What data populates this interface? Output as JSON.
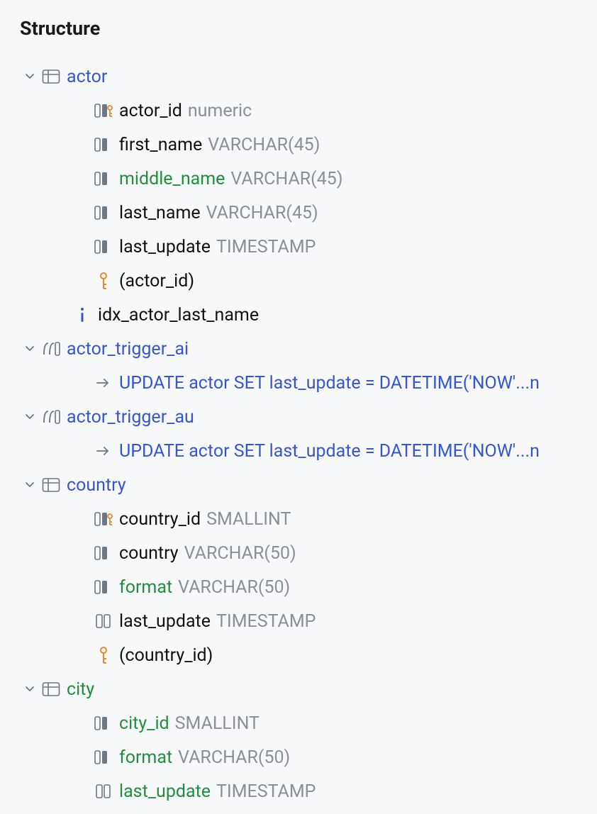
{
  "title": "Structure",
  "colors": {
    "blue": "#3556d1",
    "green": "#1f8f3b",
    "black": "#111",
    "grey": "#8a8f99",
    "orange": "#e28a2b"
  },
  "rows": [
    {
      "id": "actor",
      "depth": 0,
      "chevron": true,
      "icon": "table",
      "label": "actor",
      "label_color": "blue"
    },
    {
      "id": "actor_id",
      "depth": 1,
      "chevron": false,
      "icon": "col-key",
      "label": "actor_id",
      "label_color": "black",
      "type": "numeric"
    },
    {
      "id": "first_name",
      "depth": 1,
      "chevron": false,
      "icon": "col",
      "label": "first_name",
      "label_color": "black",
      "type": "VARCHAR(45)"
    },
    {
      "id": "middle_name",
      "depth": 1,
      "chevron": false,
      "icon": "col",
      "label": "middle_name",
      "label_color": "green",
      "type": "VARCHAR(45)"
    },
    {
      "id": "last_name",
      "depth": 1,
      "chevron": false,
      "icon": "col",
      "label": "last_name",
      "label_color": "black",
      "type": "VARCHAR(45)"
    },
    {
      "id": "last_update",
      "depth": 1,
      "chevron": false,
      "icon": "col",
      "label": "last_update",
      "label_color": "black",
      "type": "TIMESTAMP"
    },
    {
      "id": "actor_pk",
      "depth": 1,
      "chevron": false,
      "icon": "key",
      "label": "(actor_id)",
      "label_color": "black"
    },
    {
      "id": "idx_actor",
      "depth": 1,
      "chevron": false,
      "icon": "info",
      "label": "idx_actor_last_name",
      "label_color": "black",
      "indent_override": 0
    },
    {
      "id": "actor_trigger_ai",
      "depth": 0,
      "chevron": true,
      "icon": "trigger",
      "label": "actor_trigger_ai",
      "label_color": "blue"
    },
    {
      "id": "trigger_ai_body",
      "depth": 1,
      "chevron": false,
      "icon": "arrow",
      "label": "UPDATE actor SET last_update = DATETIME('NOW'...n",
      "label_color": "blue"
    },
    {
      "id": "actor_trigger_au",
      "depth": 0,
      "chevron": true,
      "icon": "trigger",
      "label": "actor_trigger_au",
      "label_color": "blue"
    },
    {
      "id": "trigger_au_body",
      "depth": 1,
      "chevron": false,
      "icon": "arrow",
      "label": "UPDATE actor SET last_update = DATETIME('NOW'...n",
      "label_color": "blue"
    },
    {
      "id": "country",
      "depth": 0,
      "chevron": true,
      "icon": "table",
      "label": "country",
      "label_color": "blue"
    },
    {
      "id": "country_id",
      "depth": 1,
      "chevron": false,
      "icon": "col-key",
      "label": "country_id",
      "label_color": "black",
      "type": "SMALLINT"
    },
    {
      "id": "country_col",
      "depth": 1,
      "chevron": false,
      "icon": "col",
      "label": "country",
      "label_color": "black",
      "type": "VARCHAR(50)"
    },
    {
      "id": "country_format",
      "depth": 1,
      "chevron": false,
      "icon": "col",
      "label": "format",
      "label_color": "green",
      "type": "VARCHAR(50)"
    },
    {
      "id": "country_lu",
      "depth": 1,
      "chevron": false,
      "icon": "col-plain",
      "label": "last_update",
      "label_color": "black",
      "type": "TIMESTAMP"
    },
    {
      "id": "country_pk",
      "depth": 1,
      "chevron": false,
      "icon": "key",
      "label": "(country_id)",
      "label_color": "black"
    },
    {
      "id": "city",
      "depth": 0,
      "chevron": true,
      "icon": "table",
      "label": "city",
      "label_color": "green"
    },
    {
      "id": "city_id",
      "depth": 1,
      "chevron": false,
      "icon": "col",
      "label": "city_id",
      "label_color": "green",
      "type": "SMALLINT"
    },
    {
      "id": "city_format",
      "depth": 1,
      "chevron": false,
      "icon": "col",
      "label": "format",
      "label_color": "green",
      "type": "VARCHAR(50)"
    },
    {
      "id": "city_lu",
      "depth": 1,
      "chevron": false,
      "icon": "col-plain",
      "label": "last_update",
      "label_color": "green",
      "type": "TIMESTAMP"
    }
  ]
}
